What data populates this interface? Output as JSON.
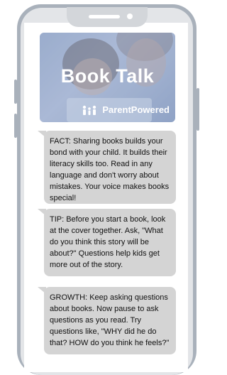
{
  "banner": {
    "title": "Book Talk",
    "brand": "ParentPowered"
  },
  "messages": [
    {
      "text": "FACT: Sharing books builds your bond with your child. It builds their literacy skills too. Read in any language and don't worry about mistakes. Your voice makes books special!"
    },
    {
      "text": "TIP: Before you start a book, look at the cover together. Ask, \"What do you think this story will be about?\" Questions help kids get more out of the story."
    },
    {
      "text": "GROWTH: Keep asking questions about books. Now pause to ask questions as you read. Try questions like, \"WHY did he do that? HOW do you think he feels?\""
    }
  ],
  "colors": {
    "phone_frame": "#a9b1bb",
    "bubble": "#d4d4d4",
    "banner_overlay": "#a6b5d2"
  }
}
